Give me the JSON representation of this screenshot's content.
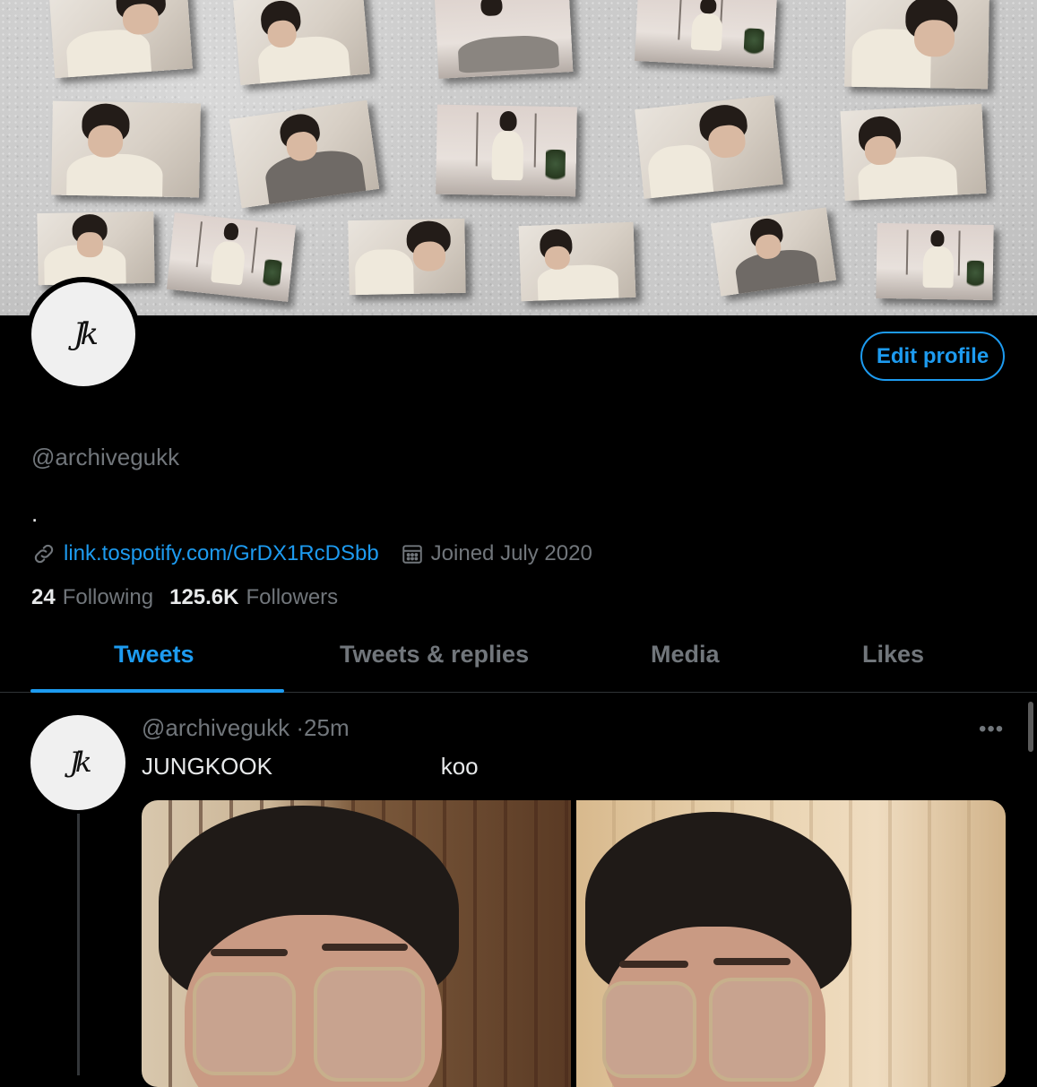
{
  "profile": {
    "handle": "@archivegukk",
    "bio": ".",
    "link": "link.tospotify.com/GrDX1RcDSbb",
    "joined": "Joined July 2020",
    "following_count": "24",
    "following_label": "Following",
    "followers_count": "125.6K",
    "followers_label": "Followers",
    "avatar_logo": "Jk",
    "edit_button_label": "Edit profile"
  },
  "icons": {
    "link": "link-icon",
    "calendar": "calendar-icon",
    "more": "more-icon"
  },
  "tabs": [
    {
      "label": "Tweets",
      "active": true
    },
    {
      "label": "Tweets & replies",
      "active": false
    },
    {
      "label": "Media",
      "active": false
    },
    {
      "label": "Likes",
      "active": false
    }
  ],
  "tweet": {
    "handle": "@archivegukk",
    "separator": "·",
    "time": "25m",
    "text": "JUNGKOOK                          koo",
    "more_label": "•••"
  },
  "colors": {
    "accent": "#1d9bf0",
    "background": "#000000",
    "muted_text": "#71767b",
    "primary_text": "#e7e9ea",
    "divider": "#2f3336"
  }
}
